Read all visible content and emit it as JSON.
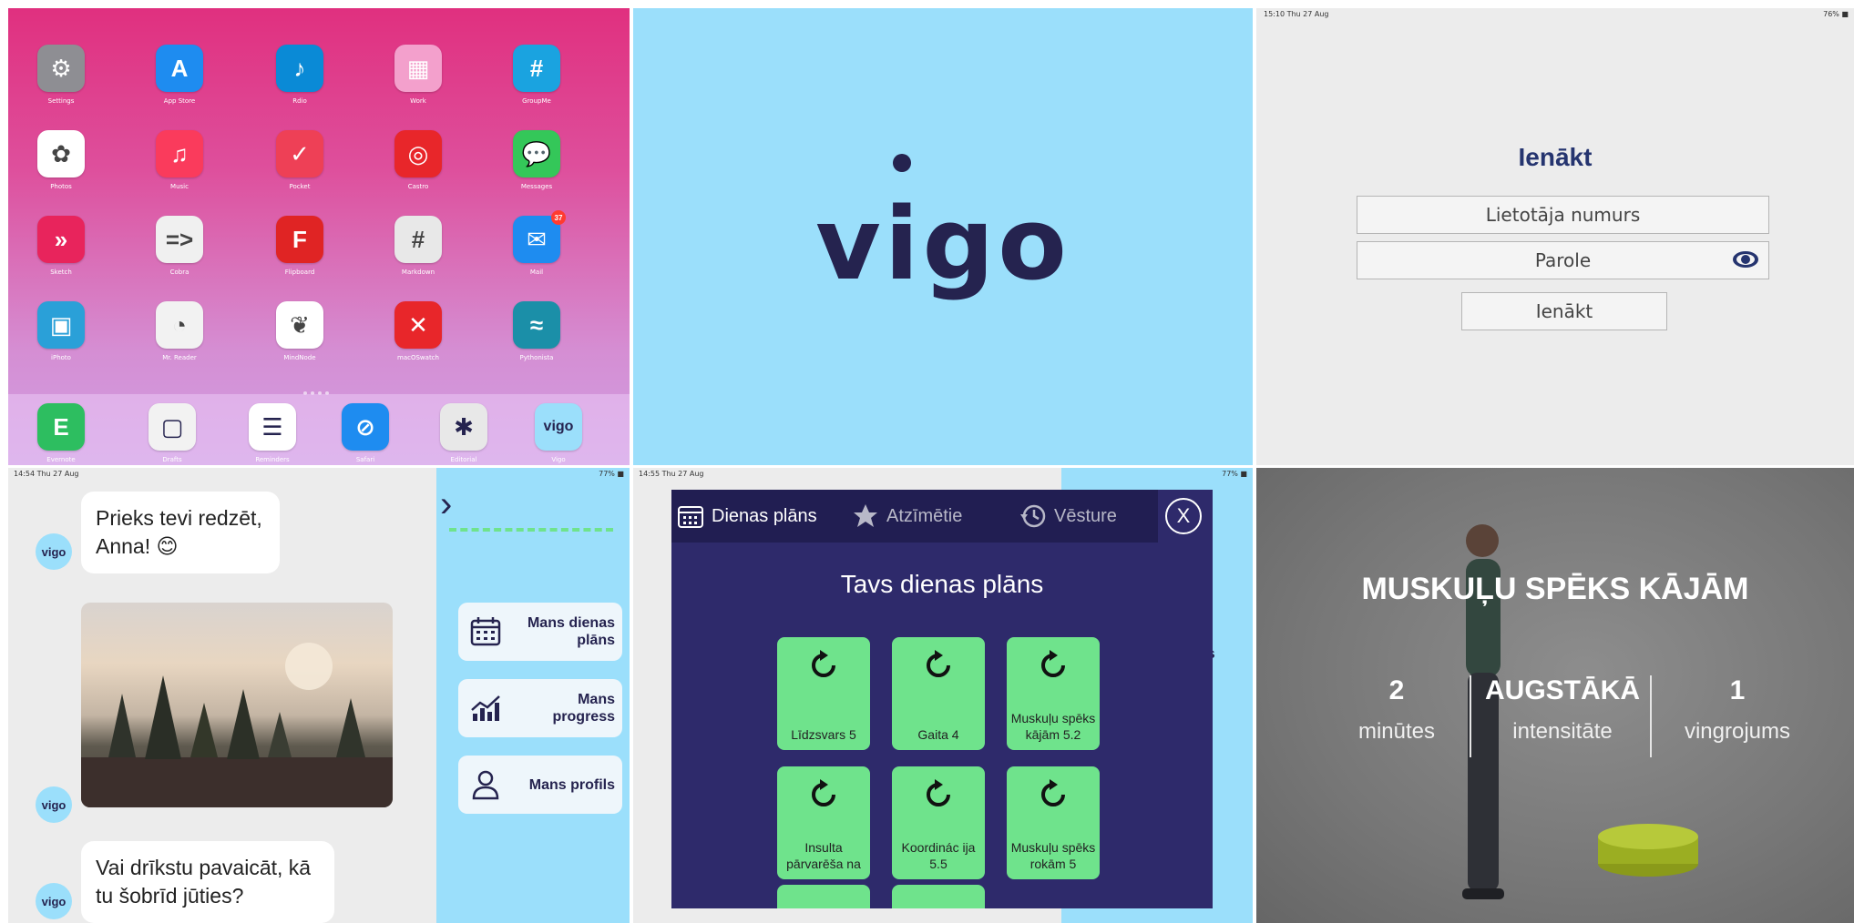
{
  "home": {
    "apps": [
      {
        "label": "Settings",
        "color": "#8e8e93",
        "glyph": "⚙"
      },
      {
        "label": "App Store",
        "color": "#1e8cf0",
        "glyph": "A"
      },
      {
        "label": "Rdio",
        "color": "#0a8ad6",
        "glyph": "♪"
      },
      {
        "label": "Work",
        "color": "#f3a0cc",
        "glyph": "▦"
      },
      {
        "label": "GroupMe",
        "color": "#1aa3e0",
        "glyph": "#"
      },
      {
        "label": "Photos",
        "color": "#ffffff",
        "glyph": "✿"
      },
      {
        "label": "Music",
        "color": "#fa3b5c",
        "glyph": "♫"
      },
      {
        "label": "Pocket",
        "color": "#ee4056",
        "glyph": "✓"
      },
      {
        "label": "Castro",
        "color": "#e8262a",
        "glyph": "◎"
      },
      {
        "label": "Messages",
        "color": "#34c759",
        "glyph": "💬"
      },
      {
        "label": "Sketch",
        "color": "#e8245c",
        "glyph": "»"
      },
      {
        "label": "Cobra",
        "color": "#f0f0f0",
        "glyph": "=>"
      },
      {
        "label": "Flipboard",
        "color": "#e02424",
        "glyph": "F"
      },
      {
        "label": "Markdown",
        "color": "#e8e8e8",
        "glyph": "#"
      },
      {
        "label": "Mail",
        "color": "#1e8cf0",
        "glyph": "✉",
        "badge": "37"
      },
      {
        "label": "iPhoto",
        "color": "#2aa0d8",
        "glyph": "▣"
      },
      {
        "label": "Mr. Reader",
        "color": "#f2f2f2",
        "glyph": "◔"
      },
      {
        "label": "MindNode",
        "color": "#ffffff",
        "glyph": "❦"
      },
      {
        "label": "macOSwatch",
        "color": "#e8262a",
        "glyph": "✕"
      },
      {
        "label": "Pythonista",
        "color": "#1b8fa8",
        "glyph": "≈"
      }
    ],
    "dock": [
      {
        "label": "Evernote",
        "color": "#2dbe60",
        "glyph": "E"
      },
      {
        "label": "Drafts",
        "color": "#f2f2f2",
        "glyph": "▢"
      },
      {
        "label": "Reminders",
        "color": "#ffffff",
        "glyph": "☰"
      },
      {
        "label": "Safari",
        "color": "#1e8cf0",
        "glyph": "⊘"
      },
      {
        "label": "Editorial",
        "color": "#e8e8e8",
        "glyph": "✱"
      },
      {
        "label": "Vigo",
        "color": "#9bdffb",
        "glyph": "vigo"
      }
    ]
  },
  "splash": {
    "logo": "vigo"
  },
  "login": {
    "status_time": "15:10  Thu 27 Aug",
    "status_battery": "76% ■",
    "title": "Ienākt",
    "user_placeholder": "Lietotāja numurs",
    "password_placeholder": "Parole",
    "submit": "Ienākt"
  },
  "chat": {
    "status_time": "14:54  Thu 27 Aug",
    "status_battery": "77% ■",
    "avatar": "vigo",
    "msg1": "Prieks tevi redzēt, Anna! 😊",
    "msg2": "Vai drīkstu pavaicāt, kā tu šobrīd jūties?",
    "back": "›",
    "menu": [
      {
        "title": "Mans dienas plāns"
      },
      {
        "title": "Mans progress"
      },
      {
        "title": "Mans profils"
      }
    ]
  },
  "plan": {
    "status_time": "14:55  Thu 27 Aug",
    "status_battery": "77% ■",
    "tabs": [
      "Dienas plāns",
      "Atzīmētie",
      "Vēsture"
    ],
    "close": "X",
    "title": "Tavs dienas plāns",
    "cards": [
      "Līdzsvars 5",
      "Gaita 4",
      "Muskuļu spēks kājām 5.2",
      "Insulta pārvarēša na",
      "Koordinác ija 5.5",
      "Muskuļu spēks rokām 5"
    ],
    "side_text": "ns"
  },
  "exercise": {
    "title": "MUSKUĻU SPĒKS KĀJĀM",
    "stats": [
      {
        "value": "2",
        "label": "minūtes"
      },
      {
        "value": "AUGSTĀKĀ",
        "label": "intensitāte"
      },
      {
        "value": "1",
        "label": "vingrojums"
      }
    ]
  },
  "colors": {
    "navy": "#25234f",
    "sky": "#9bdffb",
    "modal": "#2e2a6b",
    "green": "#6fe38c",
    "login_title": "#25346f"
  }
}
